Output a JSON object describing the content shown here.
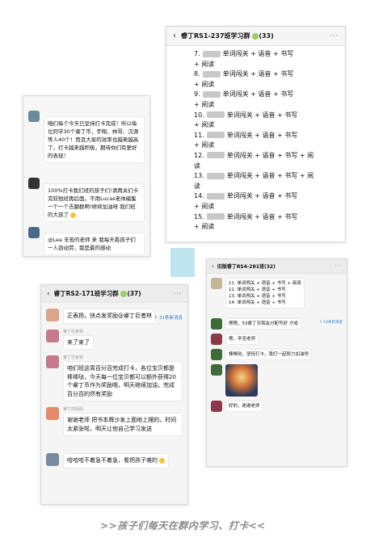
{
  "cardA": {
    "messages": [
      {
        "text": "咱们每个今天已坚持打卡完成！听以每位同学30个睿丁币，宇翔、林哥、汉源等人40个！而且大家的效率也越来越高了，打卡越来越积极，期待你们有更好的表现！"
      },
      {
        "text": "100%打卡我们班的孩子们!请再关们卡完较他班再后面。不用Lucas老帅编集一个一个去翻群啊!继续加油呀 我们班的大孩了"
      },
      {
        "text": "@Lea 辛苦的老师 来 我每天看孩子们一人劲动劳，我是最的感动"
      }
    ]
  },
  "cardB": {
    "title": "睿丁RS1-237班学习群",
    "count": "(33)",
    "more": "···",
    "items": [
      {
        "num": "7.",
        "text": "单词闯关 + 语音 + 书写"
      },
      {
        "num": "",
        "text": "+ 阅读"
      },
      {
        "num": "8.",
        "text": "单词闯关 + 语音 + 书写"
      },
      {
        "num": "",
        "text": "+ 阅读"
      },
      {
        "num": "9.",
        "text": "单词闯关 + 语音 + 书写"
      },
      {
        "num": "",
        "text": "+ 阅读"
      },
      {
        "num": "10.",
        "text": "单词闯关 + 语音 + 书写"
      },
      {
        "num": "",
        "text": "+ 阅读"
      },
      {
        "num": "11.",
        "text": "单词闯关 + 语音 + 书写"
      },
      {
        "num": "",
        "text": "+ 阅读"
      },
      {
        "num": "12.",
        "text": "单词闯关 + 语音 + 书写 + 阅"
      },
      {
        "num": "",
        "text": "读"
      },
      {
        "num": "13.",
        "text": "单词闯关 + 语音 + 书写 + 阅"
      },
      {
        "num": "",
        "text": "读"
      },
      {
        "num": "14.",
        "text": "单词闯关 + 语音 + 书写"
      },
      {
        "num": "",
        "text": "+ 阅读"
      },
      {
        "num": "15.",
        "text": "单词闯关 + 语音 + 书写"
      },
      {
        "num": "",
        "text": "+ 阅读"
      }
    ]
  },
  "cardC": {
    "title": "睿丁RS2-171班学习群",
    "count": "(37)",
    "more": "···",
    "new_messages": "31条新消息",
    "messages": [
      {
        "sender": "",
        "text": "正表扬，快点发奖励@睿丁巨者林"
      },
      {
        "sender": "睿丁巨者林",
        "text": "来了来了"
      },
      {
        "sender": "睿丁巨者林",
        "text": "咱们班这周百分百完成打卡，各位宝贝都是棒棒哒，今天每一位宝贝都可以额外获得20个睿丁币作为奖励哦，明天继续加油，完成百分百的然有奖励"
      },
      {
        "sender": "睿丁的妈妈",
        "text": "谢谢老师 把书本牌沙发上面地上摆的，时间太紧张啦，明天让他自己学习发送"
      },
      {
        "sender": "",
        "text": "哈哈哈不着急不着急，看把孩子难的"
      }
    ]
  },
  "cardD": {
    "title": "旧版睿丁RS4-281班",
    "count": "(32)",
    "more": "···",
    "new_messages": "14条新消息",
    "top_lines": [
      "11. 单词闯关 + 语音 + 书写 + 阅读",
      "12. 单词闯关 + 语音 + 书写",
      "13. 单词闯关 + 语音 + 书写",
      "14. 单词闯关 + 语音 + 书写"
    ],
    "messages": [
      {
        "text": "嗯嗯，53睿丁币我会分配写好 才成"
      },
      {
        "text": "嗯，辛苦老师"
      },
      {
        "text": "棒棒哒，坚持打卡，我们一起努力加油吧"
      },
      {
        "text": "好的，谢谢老师"
      }
    ]
  },
  "caption": ">>孩子们每天在群内学习、打卡<<"
}
